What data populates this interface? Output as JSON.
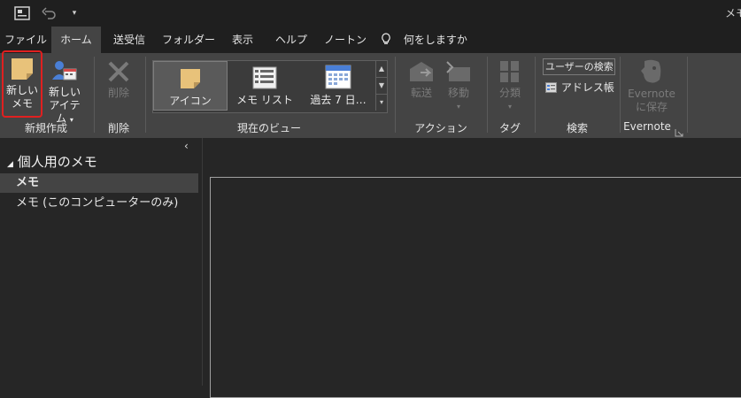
{
  "window": {
    "title": "メモ"
  },
  "tabs": [
    {
      "label": "ファイル"
    },
    {
      "label": "ホーム"
    },
    {
      "label": "送受信"
    },
    {
      "label": "フォルダー"
    },
    {
      "label": "表示"
    },
    {
      "label": "ヘルプ"
    },
    {
      "label": "ノートン"
    },
    {
      "label": "何をしますか"
    }
  ],
  "ribbon": {
    "new_group": {
      "new_note_line1": "新しい",
      "new_note_line2": "メモ",
      "new_item_line1": "新しい",
      "new_item_line2": "アイテム",
      "label": "新規作成"
    },
    "delete_group": {
      "delete_label": "削除",
      "label": "削除"
    },
    "view_group": {
      "items": [
        {
          "label": "アイコン"
        },
        {
          "label": "メモ リスト"
        },
        {
          "label": "過去 7 日…"
        }
      ],
      "label": "現在のビュー"
    },
    "action_group": {
      "forward_label": "転送",
      "move_label": "移動",
      "label": "アクション"
    },
    "tags_group": {
      "categorize_label": "分類",
      "label": "タグ"
    },
    "search_group": {
      "user_search_label": "ユーザーの検索",
      "address_book_label": "アドレス帳",
      "label": "検索"
    },
    "evernote_group": {
      "save_line1": "Evernote",
      "save_line2": "に保存",
      "label": "Evernote"
    }
  },
  "nav": {
    "section_label": "個人用のメモ",
    "items": [
      {
        "label": "メモ"
      },
      {
        "label": "メモ (このコンピューターのみ)"
      }
    ]
  },
  "colors": {
    "highlight_box": "#e02020",
    "note_yellow": "#e8c27a",
    "accent_blue": "#4a7fd6"
  },
  "icons": [
    "app-icon",
    "undo-icon",
    "quick-access-dropdown-icon",
    "lightbulb-icon",
    "note-icon",
    "new-item-icon",
    "delete-x-icon",
    "note-list-icon",
    "calendar-icon",
    "forward-icon",
    "move-icon",
    "categorize-icon",
    "address-book-icon",
    "evernote-icon",
    "collapse-chevron-icon",
    "dialog-launcher-icon"
  ]
}
